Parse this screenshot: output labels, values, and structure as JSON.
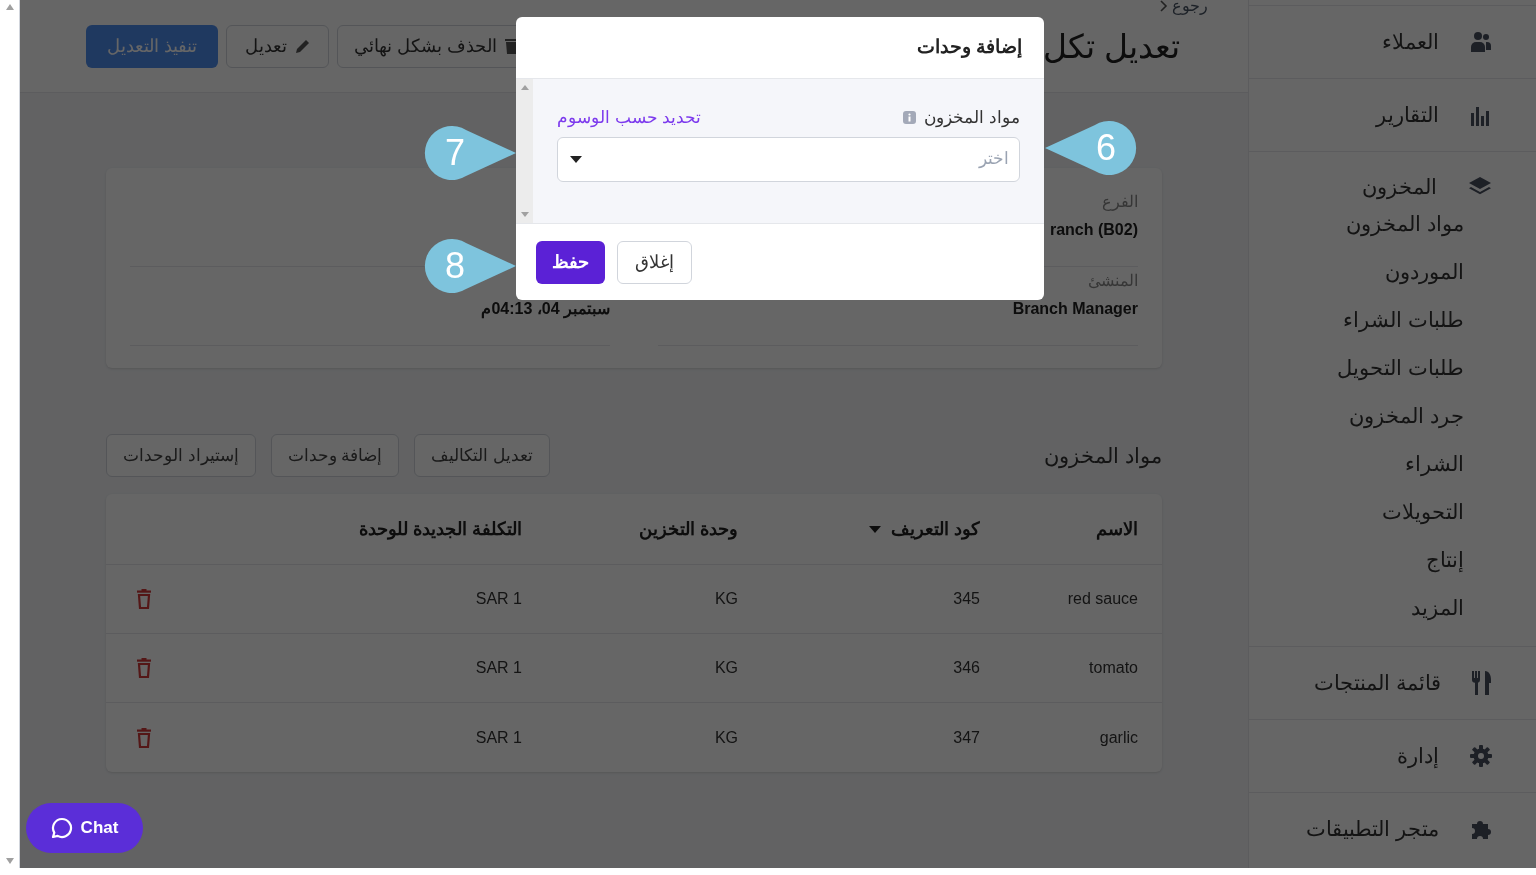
{
  "breadcrumb": "رجوع",
  "page_title": "تعديل تكل",
  "toolbar_buttons": [
    {
      "label": "الحذف بشكل نهائي",
      "kind": "delete"
    },
    {
      "label": "تعديل",
      "kind": "edit"
    },
    {
      "label": "تنفيذ التعديل",
      "kind": "primary"
    }
  ],
  "details": {
    "right": [
      {
        "label": "الفرع",
        "value": "ranch (B02)"
      },
      {
        "label": "المنشئ",
        "value": "Branch Manager"
      }
    ],
    "left": [
      {
        "value": "سبتمبر 04، 04:13م"
      }
    ]
  },
  "items_section": {
    "title": "مواد المخزون",
    "buttons": [
      "تعديل التكاليف",
      "إضافة وحدات",
      "إستيراد الوحدات"
    ],
    "columns": [
      {
        "label": "الاسم",
        "sorted": false
      },
      {
        "label": "كود التعريف",
        "sorted": true
      },
      {
        "label": "وحدة التخزين",
        "sorted": false
      },
      {
        "label": "التكلفة الجديدة للوحدة",
        "sorted": false
      }
    ],
    "rows": [
      [
        "red sauce",
        "345",
        "KG",
        "SAR 1"
      ],
      [
        "tomato",
        "346",
        "KG",
        "SAR 1"
      ],
      [
        "garlic",
        "347",
        "KG",
        "SAR 1"
      ]
    ]
  },
  "sidebar": {
    "items": [
      {
        "label": "العملاء"
      },
      {
        "label": "التقارير"
      },
      {
        "label": "المخزون",
        "children": [
          {
            "label": "مواد المخزون"
          },
          {
            "label": "الموردون"
          },
          {
            "label": "طلبات الشراء"
          },
          {
            "label": "طلبات التحويل"
          },
          {
            "label": "جرد المخزون"
          },
          {
            "label": "الشراء"
          },
          {
            "label": "التحويلات"
          },
          {
            "label": "إنتاج"
          },
          {
            "label": "المزيد"
          }
        ]
      },
      {
        "label": "قائمة المنتجات"
      },
      {
        "label": "إدارة"
      },
      {
        "label": "متجر التطبيقات"
      }
    ]
  },
  "modal": {
    "title": "إضافة وحدات",
    "field": {
      "label": "مواد المخزون",
      "link": "تحديد حسب الوسوم",
      "placeholder": "اختر"
    },
    "buttons": [
      {
        "label": "إغلاق",
        "kind": "secondary"
      },
      {
        "label": "حفظ",
        "kind": "primary"
      }
    ]
  },
  "callouts": [
    {
      "number": "6"
    },
    {
      "number": "7"
    },
    {
      "number": "8"
    }
  ],
  "chat": {
    "label": "Chat"
  }
}
